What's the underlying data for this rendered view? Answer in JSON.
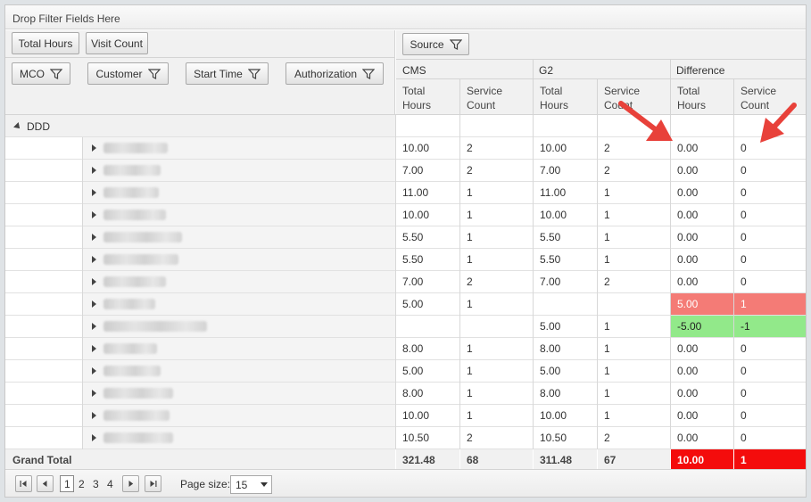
{
  "toolbar": {
    "drop_filter_text": "Drop Filter Fields Here"
  },
  "data_fields": [
    "Total Hours",
    "Visit Count"
  ],
  "column_field": "Source",
  "row_fields": [
    "MCO",
    "Customer",
    "Start Time",
    "Authorization"
  ],
  "column_groups": [
    "CMS",
    "G2",
    "Difference"
  ],
  "sub_headers": [
    [
      "Total",
      "Hours"
    ],
    [
      "Service",
      "Count"
    ],
    [
      "Total",
      "Hours"
    ],
    [
      "Service",
      "Count"
    ],
    [
      "Total",
      "Hours"
    ],
    [
      "Service",
      "Count"
    ]
  ],
  "group_label": "DDD",
  "rows": [
    [
      "10.00",
      "2",
      "10.00",
      "2",
      "0.00",
      "0"
    ],
    [
      "7.00",
      "2",
      "7.00",
      "2",
      "0.00",
      "0"
    ],
    [
      "11.00",
      "1",
      "11.00",
      "1",
      "0.00",
      "0"
    ],
    [
      "10.00",
      "1",
      "10.00",
      "1",
      "0.00",
      "0"
    ],
    [
      "5.50",
      "1",
      "5.50",
      "1",
      "0.00",
      "0"
    ],
    [
      "5.50",
      "1",
      "5.50",
      "1",
      "0.00",
      "0"
    ],
    [
      "7.00",
      "2",
      "7.00",
      "2",
      "0.00",
      "0"
    ],
    [
      "5.00",
      "1",
      "",
      "",
      "5.00",
      "1"
    ],
    [
      "",
      "",
      "5.00",
      "1",
      "-5.00",
      "-1"
    ],
    [
      "8.00",
      "1",
      "8.00",
      "1",
      "0.00",
      "0"
    ],
    [
      "5.00",
      "1",
      "5.00",
      "1",
      "0.00",
      "0"
    ],
    [
      "8.00",
      "1",
      "8.00",
      "1",
      "0.00",
      "0"
    ],
    [
      "10.00",
      "1",
      "10.00",
      "1",
      "0.00",
      "0"
    ],
    [
      "10.50",
      "2",
      "10.50",
      "2",
      "0.00",
      "0"
    ]
  ],
  "highlights": {
    "positive": "#f47b76",
    "negative": "#92e98a",
    "total": "#f40c0c"
  },
  "grand_total": {
    "label": "Grand Total",
    "values": [
      "321.48",
      "68",
      "311.48",
      "67",
      "10.00",
      "1"
    ]
  },
  "pager": {
    "pages": [
      "1",
      "2",
      "3",
      "4"
    ],
    "current": "1",
    "page_size_label": "Page size:",
    "page_size": "15"
  },
  "annotation_color": "#e8413a"
}
